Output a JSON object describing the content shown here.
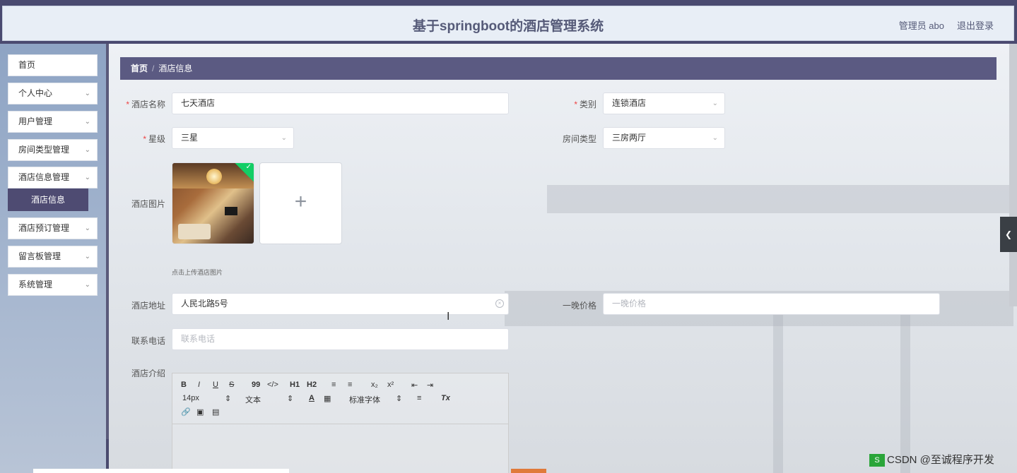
{
  "header": {
    "title": "基于springboot的酒店管理系统",
    "user": "管理员 abo",
    "logout": "退出登录"
  },
  "sidebar": {
    "items": [
      {
        "label": "首页",
        "has_children": false
      },
      {
        "label": "个人中心",
        "has_children": true
      },
      {
        "label": "用户管理",
        "has_children": true
      },
      {
        "label": "房间类型管理",
        "has_children": true
      },
      {
        "label": "酒店信息管理",
        "has_children": true
      },
      {
        "label": "酒店预订管理",
        "has_children": true
      },
      {
        "label": "留言板管理",
        "has_children": true
      },
      {
        "label": "系统管理",
        "has_children": true
      }
    ],
    "active_submenu": "酒店信息"
  },
  "breadcrumb": {
    "home": "首页",
    "separator": "/",
    "current": "酒店信息"
  },
  "form": {
    "hotel_name": {
      "label": "酒店名称",
      "value": "七天酒店",
      "required": true
    },
    "category": {
      "label": "类别",
      "value": "连锁酒店",
      "required": true
    },
    "star_level": {
      "label": "星级",
      "value": "三星",
      "required": true
    },
    "room_type": {
      "label": "房间类型",
      "value": "三房两厅",
      "required": false
    },
    "hotel_image": {
      "label": "酒店图片",
      "hint": "点击上传酒店图片",
      "upload_symbol": "+"
    },
    "address": {
      "label": "酒店地址",
      "value": "人民北路5号"
    },
    "price": {
      "label": "一晚价格",
      "placeholder": "一晚价格"
    },
    "phone": {
      "label": "联系电话",
      "placeholder": "联系电话"
    },
    "intro": {
      "label": "酒店介绍"
    }
  },
  "editor_toolbar": {
    "row1": [
      "B",
      "I",
      "U",
      "S",
      "99",
      "</>",
      "H1",
      "H2",
      "≡",
      "≡",
      "x₂",
      "x²",
      "⇤",
      "⇥"
    ],
    "font_size": "14px",
    "text_type": "文本",
    "font_family": "标准字体",
    "clear_format": "Tx"
  },
  "required_mark": "*",
  "watermark": {
    "logo": "S",
    "text": "CSDN @至诚程序开发"
  },
  "colors": {
    "header_bg": "#e8eef6",
    "topbar": "#4a4a70",
    "breadcrumb_bg": "#5b5a82",
    "active_submenu_bg": "#4e4b72",
    "required": "#ee4444"
  }
}
